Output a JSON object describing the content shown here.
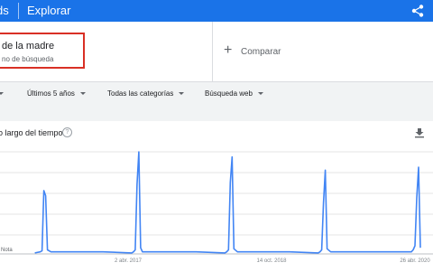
{
  "header": {
    "brand": "ds",
    "nav_label": "Explorar",
    "share_icon": "share-icon"
  },
  "search_term": {
    "name": "de la madre",
    "type": "no de búsqueda"
  },
  "compare": {
    "label": "Comparar"
  },
  "filters": {
    "region": "",
    "time_range": "Últimos 5 años",
    "category": "Todas las categorías",
    "search_type": "Búsqueda web"
  },
  "card": {
    "title": "o largo del tiempo",
    "help_glyph": "?",
    "download_icon": "download-icon"
  },
  "chart_data": {
    "type": "line",
    "x_ticks": [
      "2 abr. 2017",
      "14 oct. 2018",
      "26 abr. 2020"
    ],
    "annotation": "Nota",
    "series": [
      {
        "color": "#4285f4",
        "points": [
          [
            "2016-04-03",
            1
          ],
          [
            "2016-04-24",
            2
          ],
          [
            "2016-05-01",
            3
          ],
          [
            "2016-05-08",
            62
          ],
          [
            "2016-05-15",
            57
          ],
          [
            "2016-05-22",
            4
          ],
          [
            "2016-06-05",
            2
          ],
          [
            "2016-08-14",
            2
          ],
          [
            "2016-12-25",
            2
          ],
          [
            "2017-04-16",
            1
          ],
          [
            "2017-04-23",
            2
          ],
          [
            "2017-04-30",
            4
          ],
          [
            "2017-05-07",
            68
          ],
          [
            "2017-05-14",
            100
          ],
          [
            "2017-05-21",
            6
          ],
          [
            "2017-05-28",
            2
          ],
          [
            "2017-10-01",
            2
          ],
          [
            "2017-12-24",
            2
          ],
          [
            "2018-04-15",
            1
          ],
          [
            "2018-04-22",
            2
          ],
          [
            "2018-04-29",
            4
          ],
          [
            "2018-05-06",
            70
          ],
          [
            "2018-05-13",
            95
          ],
          [
            "2018-05-20",
            5
          ],
          [
            "2018-06-03",
            2
          ],
          [
            "2018-10-14",
            2
          ],
          [
            "2018-12-23",
            2
          ],
          [
            "2019-04-14",
            1
          ],
          [
            "2019-04-21",
            2
          ],
          [
            "2019-04-28",
            4
          ],
          [
            "2019-05-05",
            50
          ],
          [
            "2019-05-12",
            82
          ],
          [
            "2019-05-19",
            5
          ],
          [
            "2019-06-02",
            2
          ],
          [
            "2019-09-15",
            2
          ],
          [
            "2019-12-22",
            2
          ],
          [
            "2020-04-12",
            2
          ],
          [
            "2020-04-19",
            4
          ],
          [
            "2020-04-26",
            8
          ],
          [
            "2020-05-03",
            55
          ],
          [
            "2020-05-10",
            85
          ],
          [
            "2020-05-17",
            6
          ]
        ]
      }
    ]
  }
}
